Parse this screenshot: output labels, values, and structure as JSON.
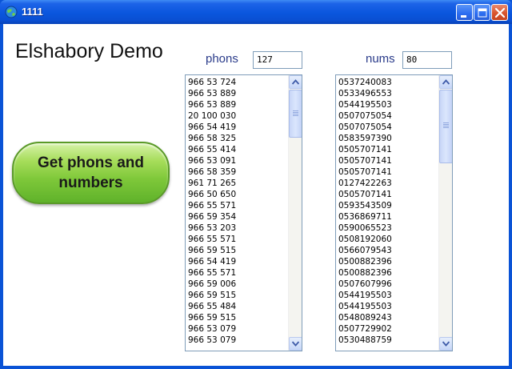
{
  "window": {
    "title": "1111"
  },
  "main": {
    "heading": "Elshabory Demo",
    "action_button_label": "Get phons and numbers"
  },
  "phons": {
    "label": "phons",
    "count_value": "127",
    "items": [
      "966 53 724",
      "966 53 889",
      "966 53 889",
      "20 100 030",
      "966 54 419",
      "966 58 325",
      "966 55 414",
      "966 53 091",
      "966 58 359",
      "961 71 265",
      "966 50 650",
      "966 55 571",
      "966 59 354",
      "966 53 203",
      "966 55 571",
      "966 59 515",
      "966 54 419",
      "966 55 571",
      "966 59 006",
      "966 59 515",
      "966 55 484",
      "966 59 515",
      "966 53 079",
      "966 53 079"
    ]
  },
  "nums": {
    "label": "nums",
    "count_value": "80",
    "items": [
      "0537240083",
      "0533496553",
      "0544195503",
      "0507075054",
      "0507075054",
      "0583597390",
      "0505707141",
      "0505707141",
      "0505707141",
      "0127422263",
      "0505707141",
      "0593543509",
      "0536869711",
      "0590065523",
      "0508192060",
      "0566079543",
      "0500882396",
      "0500882396",
      "0507607996",
      "0544195503",
      "0544195503",
      "0548089243",
      "0507729902",
      "0530488759"
    ]
  },
  "colors": {
    "titlebar": "#0a56dd",
    "button_green": "#7fc83a",
    "label_blue": "#2a3b8a"
  },
  "icons": {
    "app": "globe-icon",
    "minimize": "minimize-icon",
    "maximize": "maximize-icon",
    "close": "close-icon",
    "scroll_up": "arrow-up-icon",
    "scroll_down": "arrow-down-icon"
  }
}
